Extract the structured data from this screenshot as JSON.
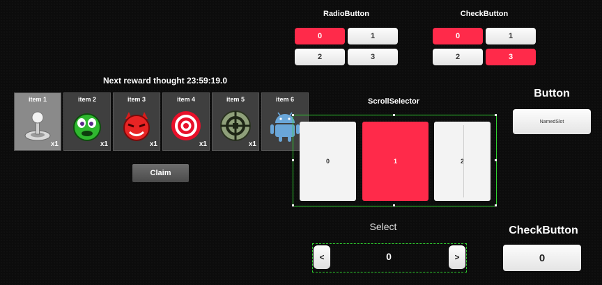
{
  "radio": {
    "title": "RadioButton",
    "options": [
      "0",
      "1",
      "2",
      "3"
    ],
    "selected": "0"
  },
  "check": {
    "title": "CheckButton",
    "options": [
      "0",
      "1",
      "2",
      "3"
    ],
    "checked": [
      "0",
      "3"
    ]
  },
  "reward": {
    "title": "Next reward thought 23:59:19.0",
    "items": [
      {
        "label": "item 1",
        "count": "x1",
        "icon": "joystick-icon"
      },
      {
        "label": "item 2",
        "count": "x1",
        "icon": "green-monster-icon"
      },
      {
        "label": "item 3",
        "count": "x1",
        "icon": "red-devil-icon"
      },
      {
        "label": "item 4",
        "count": "x1",
        "icon": "target-icon"
      },
      {
        "label": "item 5",
        "count": "x1",
        "icon": "crosshair-icon"
      },
      {
        "label": "item 6",
        "count": "",
        "icon": "android-robot-icon"
      }
    ],
    "claim_label": "Claim"
  },
  "scroll_selector": {
    "title": "ScrollSelector",
    "cards": [
      "0",
      "1",
      "2"
    ],
    "selected": "1"
  },
  "button_panel": {
    "title": "Button",
    "named_slot_label": "NamedSlot"
  },
  "select": {
    "title": "Select",
    "prev_label": "<",
    "next_label": ">",
    "value": "0"
  },
  "check_button_panel": {
    "title": "CheckButton",
    "value": "0"
  },
  "colors": {
    "accent": "#ff2a4a",
    "selection_outline": "#2fd12f",
    "background": "#0c0c0c"
  }
}
